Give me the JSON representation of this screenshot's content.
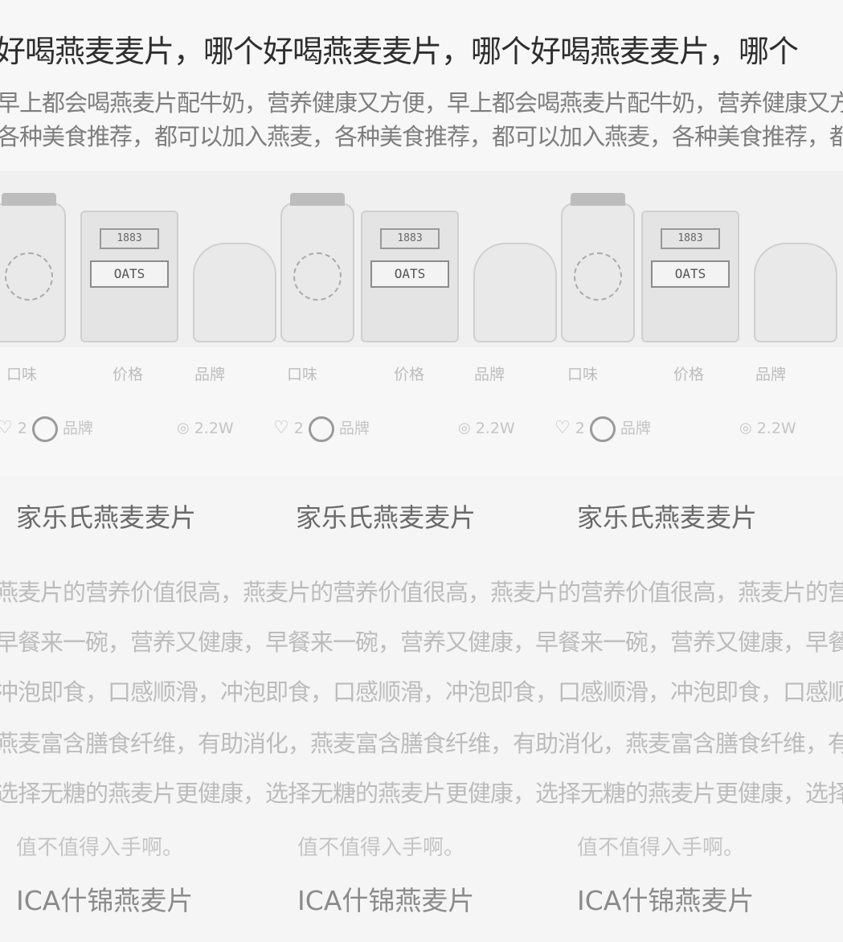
{
  "article": {
    "title": "好喝燕麦麦片，哪个好喝燕麦麦片，哪个好喝燕麦麦片，哪个",
    "desc_line1": "早上都会喝燕麦片配牛奶，营养健康又方便，早上都会喝燕麦片配牛奶，营养健康又方便，早上",
    "desc_line2": "各种美食推荐，都可以加入燕麦，各种美食推荐，都可以加入燕麦，各种美食推荐，都可以"
  },
  "products": [
    {
      "kind": "jar",
      "label": ""
    },
    {
      "kind": "box",
      "label": "OATS",
      "top": "1883"
    },
    {
      "kind": "bag",
      "label": ""
    },
    {
      "kind": "jar",
      "label": ""
    },
    {
      "kind": "box",
      "label": "OATS",
      "top": "1883"
    },
    {
      "kind": "bag",
      "label": ""
    },
    {
      "kind": "jar",
      "label": ""
    },
    {
      "kind": "box",
      "label": "OATS",
      "top": "1883"
    },
    {
      "kind": "bag",
      "label": ""
    }
  ],
  "meta": [
    {
      "a": "口味",
      "b": "价格",
      "c": "品牌"
    },
    {
      "a": "口味",
      "b": "价格",
      "c": "品牌"
    },
    {
      "a": "口味",
      "b": "价格",
      "c": "品牌"
    }
  ],
  "stats": [
    {
      "likes": "2",
      "author": "品牌",
      "views": "2.2W"
    },
    {
      "likes": "2",
      "author": "品牌",
      "views": "2.2W"
    },
    {
      "likes": "2",
      "author": "品牌",
      "views": "2.2W"
    }
  ],
  "list": {
    "item_titles": [
      "家乐氏燕麦麦片",
      "家乐氏燕麦麦片",
      "家乐氏燕麦麦片"
    ],
    "body_line1": "燕麦片的营养价值很高，燕麦片的营养价值很高，燕麦片的营养价值很高，燕麦片的营养价值很高",
    "body_line2": "早餐来一碗，营养又健康，早餐来一碗，营养又健康，早餐来一碗，营养又健康，早餐来一碗",
    "body_line3": "冲泡即食，口感顺滑，冲泡即食，口感顺滑，冲泡即食，口感顺滑，冲泡即食，口感顺滑，冲泡",
    "body_line4": "燕麦富含膳食纤维，有助消化，燕麦富含膳食纤维，有助消化，燕麦富含膳食纤维，有助消化",
    "body_line5": "选择无糖的燕麦片更健康，选择无糖的燕麦片更健康，选择无糖的燕麦片更健康，选择无糖",
    "short_lines": [
      "值不值得入手啊。",
      "值不值得入手啊。",
      "值不值得入手啊。"
    ],
    "item_titles2": [
      "ICA什锦燕麦片",
      "ICA什锦燕麦片",
      "ICA什锦燕麦片"
    ]
  }
}
